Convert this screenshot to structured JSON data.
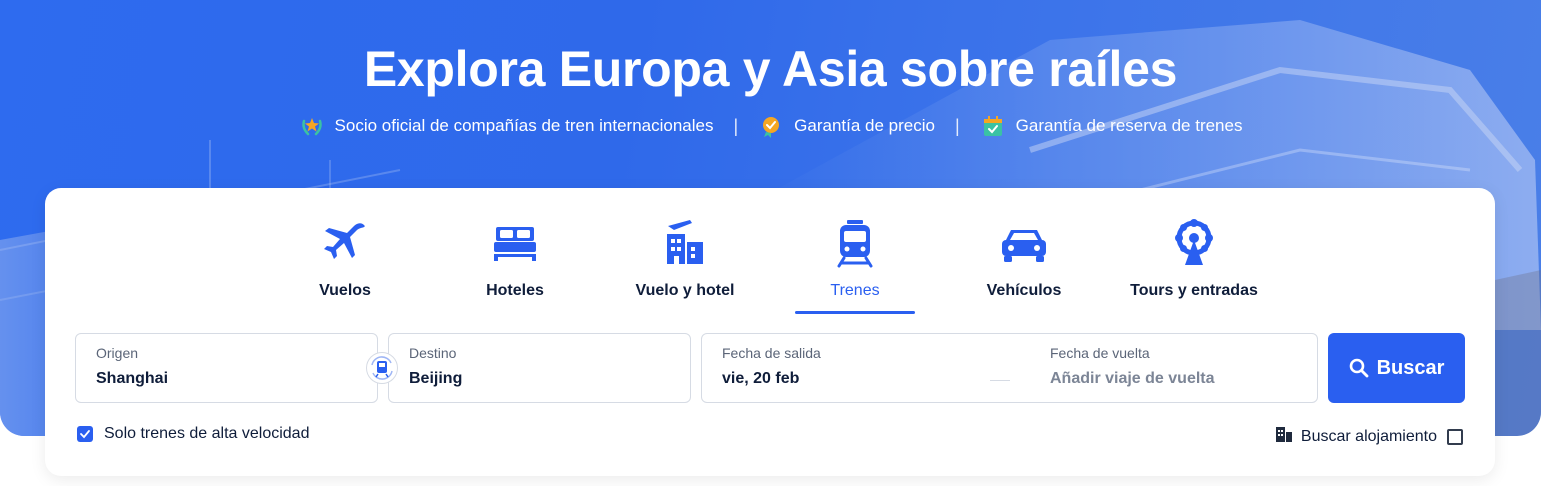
{
  "hero": {
    "title": "Explora Europa y Asia sobre raíles",
    "badges": [
      {
        "icon": "laurel-star-icon",
        "label": "Socio oficial de compañías de tren internacionales"
      },
      {
        "icon": "price-shield-icon",
        "label": "Garantía de precio"
      },
      {
        "icon": "calendar-check-icon",
        "label": "Garantía de reserva de trenes"
      }
    ],
    "separator": "|"
  },
  "tabs": [
    {
      "icon": "airplane-icon",
      "label": "Vuelos",
      "active": false
    },
    {
      "icon": "bed-icon",
      "label": "Hoteles",
      "active": false
    },
    {
      "icon": "plane-building-icon",
      "label": "Vuelo y hotel",
      "active": false
    },
    {
      "icon": "train-icon",
      "label": "Trenes",
      "active": true
    },
    {
      "icon": "car-icon",
      "label": "Vehículos",
      "active": false
    },
    {
      "icon": "ferris-wheel-icon",
      "label": "Tours y entradas",
      "active": false
    }
  ],
  "search": {
    "origin": {
      "label": "Origen",
      "value": "Shanghai"
    },
    "destination": {
      "label": "Destino",
      "value": "Beijing"
    },
    "departure": {
      "label": "Fecha de salida",
      "value": "vie, 20 feb"
    },
    "return": {
      "label": "Fecha de vuelta",
      "value": "Añadir viaje de vuelta"
    },
    "button_label": "Buscar"
  },
  "options": {
    "high_speed_only": {
      "label": "Solo trenes de alta velocidad",
      "checked": true
    },
    "search_lodging": {
      "label": "Buscar alojamiento",
      "checked": false
    }
  },
  "colors": {
    "accent": "#2a5ff0",
    "hero": "#2f69ea",
    "text": "#0f1d3a"
  }
}
